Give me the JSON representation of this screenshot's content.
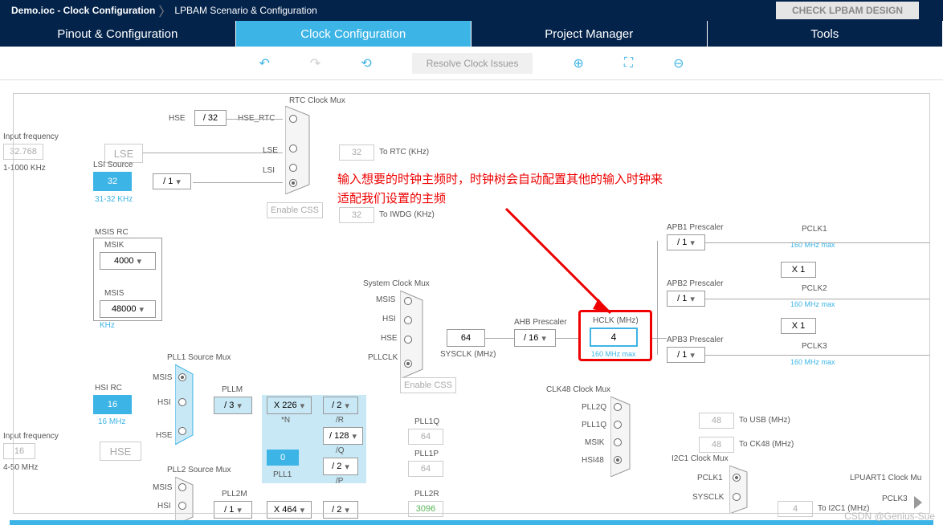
{
  "breadcrumb": {
    "item1": "Demo.ioc - Clock Configuration",
    "item2": "LPBAM Scenario & Configuration"
  },
  "check_button": "CHECK LPBAM DESIGN",
  "tabs": {
    "pinout": "Pinout & Configuration",
    "clock": "Clock Configuration",
    "project": "Project Manager",
    "tools": "Tools"
  },
  "toolbar": {
    "resolve": "Resolve Clock Issues"
  },
  "inputs": {
    "freq_label": "Input frequency",
    "val1": "32.768",
    "range1": "1-1000 KHz",
    "val2": "16",
    "range2": "4-50 MHz"
  },
  "sources": {
    "hse": "HSE",
    "lse": "LSE",
    "lsi_source": "LSI Source",
    "lsi_val": "32",
    "lsi_range": "31-32 KHz",
    "lsi": "LSI",
    "msis_rc": "MSIS RC",
    "msik": "MSIK",
    "msis": "MSIS",
    "msik_val": "4000",
    "msis_val": "48000",
    "msis_unit": "KHz",
    "hsi_rc": "HSI RC",
    "hsi_val": "16",
    "hsi_mhz": "16 MHz",
    "hsi": "HSI"
  },
  "dividers": {
    "d32": "/ 32",
    "d1": "/ 1",
    "hse_rtc": "HSE_RTC",
    "d3": "/ 3",
    "d2": "/ 2",
    "d128": "/ 128",
    "d16": "/ 16"
  },
  "rtc": {
    "title": "RTC Clock Mux",
    "rtc_val": "32",
    "rtc_label": "To RTC (KHz)",
    "iwdg_val": "32",
    "iwdg_label": "To IWDG (KHz)"
  },
  "css": {
    "enable": "Enable CSS"
  },
  "sysclk": {
    "title": "System Clock Mux",
    "msis": "MSIS",
    "hsi": "HSI",
    "hse": "HSE",
    "pllclk": "PLLCLK",
    "val": "64",
    "label": "SYSCLK (MHz)"
  },
  "ahb": {
    "label": "AHB Prescaler",
    "hclk_label": "HCLK (MHz)",
    "hclk_val": "4",
    "hclk_max": "160 MHz max"
  },
  "apb": {
    "apb1": "APB1 Prescaler",
    "apb2": "APB2 Prescaler",
    "apb3": "APB3 Prescaler",
    "pclk1": "PCLK1",
    "pclk2": "PCLK2",
    "pclk3": "PCLK3",
    "x1": "X 1",
    "max": "160 MHz max"
  },
  "pll": {
    "src1": "PLL1 Source Mux",
    "src2": "PLL2 Source Mux",
    "m": "PLLM",
    "n226": "X 226",
    "n": "*N",
    "r": "/R",
    "q": "/Q",
    "p": "/P",
    "pll1": "PLL1",
    "pll1_val": "0",
    "pll1q": "PLL1Q",
    "pll1q_val": "64",
    "pll1p": "PLL1P",
    "pll1p_val": "64",
    "pll2m": "PLL2M",
    "pll2r": "PLL2R",
    "pll2r_val": "3096",
    "n464": "X 464"
  },
  "clk48": {
    "title": "CLK48 Clock Mux",
    "pll2q": "PLL2Q",
    "pll1q": "PLL1Q",
    "msik": "MSIK",
    "hsi48": "HSI48",
    "usb_val": "48",
    "usb_label": "To USB (MHz)",
    "ck48_val": "48",
    "ck48_label": "To CK48 (MHz)"
  },
  "i2c1": {
    "title": "I2C1 Clock Mux",
    "pclk1": "PCLK1",
    "sysclk": "SYSCLK",
    "val": "4",
    "label": "To I2C1 (MHz)"
  },
  "lpuart": {
    "title": "LPUART1 Clock Mu",
    "pclk3": "PCLK3"
  },
  "annotation": {
    "line1": "输入想要的时钟主频时，时钟树会自动配置其他的输入时钟来",
    "line2": "适配我们设置的主频"
  },
  "watermark": "CSDN @Genius-Sue"
}
